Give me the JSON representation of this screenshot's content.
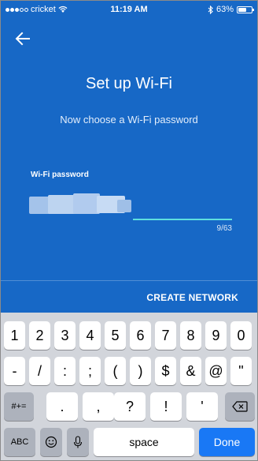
{
  "status_bar": {
    "carrier": "cricket",
    "time": "11:19 AM",
    "battery": "63%",
    "battery_level": 0.63
  },
  "header": {
    "back_icon": "arrow-left-icon",
    "title": "Set up Wi-Fi",
    "subtitle": "Now choose a Wi-Fi password"
  },
  "password_field": {
    "label": "Wi-Fi password",
    "counter": "9/63"
  },
  "actions": {
    "create_network": "CREATE NETWORK"
  },
  "keyboard": {
    "row1": [
      "1",
      "2",
      "3",
      "4",
      "5",
      "6",
      "7",
      "8",
      "9",
      "0"
    ],
    "row2": [
      "-",
      "/",
      ":",
      ";",
      "(",
      ")",
      "$",
      "&",
      "@",
      "\""
    ],
    "row3_left": "#+=",
    "row3": [
      ".",
      ",",
      "?",
      "!",
      "'"
    ],
    "row4_abc": "ABC",
    "row4_space": "space",
    "row4_done": "Done"
  },
  "colors": {
    "app_background": "#1768c6",
    "accent_line": "#5ee0df",
    "done_key": "#1978f5"
  }
}
